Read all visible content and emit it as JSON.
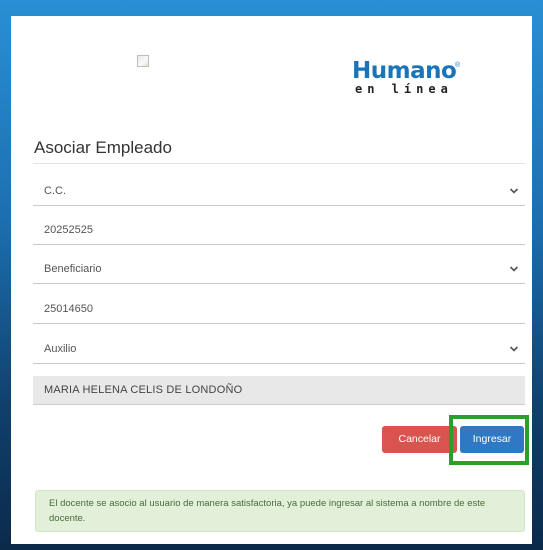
{
  "logo": {
    "main": "Humano",
    "reg": "®",
    "sub": "en línea"
  },
  "form": {
    "title": "Asociar Empleado",
    "doc_type": "C.C.",
    "doc_number": "20252525",
    "relation": "Beneficiario",
    "beneficiary_number": "25014650",
    "category": "Auxilio",
    "employee_name": "MARIA  HELENA CELIS  DE LONDOÑO"
  },
  "actions": {
    "cancel_label": "Cancelar",
    "submit_label": "Ingresar"
  },
  "alert": {
    "message": "El docente se asocio al usuario de manera satisfactoria, ya puede ingresar al sistema a nombre de este docente."
  },
  "colors": {
    "primary": "#2f78c4",
    "danger": "#d9534f",
    "success_bg": "#e2f0d9",
    "highlight": "#2aa02a",
    "logo_blue": "#1a74b8"
  },
  "icons": {
    "select_arrow": "chevron-down-icon",
    "broken_image": "broken-image-icon"
  }
}
